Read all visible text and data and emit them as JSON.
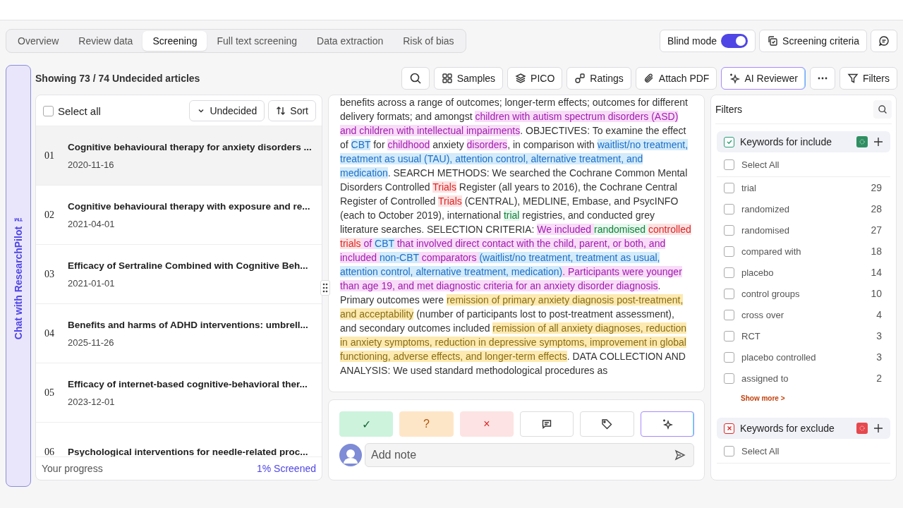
{
  "tabs": [
    {
      "label": "Overview",
      "selected": false
    },
    {
      "label": "Review data",
      "selected": false
    },
    {
      "label": "Screening",
      "selected": true
    },
    {
      "label": "Full text screening",
      "selected": false
    },
    {
      "label": "Data extraction",
      "selected": false
    },
    {
      "label": "Risk of bias",
      "selected": false
    }
  ],
  "blind_mode": {
    "label": "Blind mode",
    "on": true
  },
  "criteria_button": "Screening criteria",
  "chat_tab": "Chat with ResearchPilot ™",
  "heading": "Showing 73 / 74 Undecided articles",
  "toolbar": [
    {
      "label": "Samples",
      "kind": "plain"
    },
    {
      "label": "PICO",
      "kind": "plain"
    },
    {
      "label": "Ratings",
      "kind": "plain"
    },
    {
      "label": "Attach PDF",
      "kind": "plain"
    },
    {
      "label": "AI Reviewer",
      "kind": "ai"
    },
    {
      "label": "Filters",
      "kind": "plain"
    }
  ],
  "list": {
    "select_all": {
      "label": "Select all",
      "checked": false
    },
    "status_filter": "Undecided",
    "sort": "Sort",
    "articles": [
      {
        "number": "01",
        "title": "Cognitive behavioural therapy for anxiety disorders ...",
        "date": "2020-11-16",
        "selected": true
      },
      {
        "number": "02",
        "title": "Cognitive behavioural therapy with exposure and re...",
        "date": "2021-04-01",
        "selected": false
      },
      {
        "number": "03",
        "title": "Efficacy of Sertraline Combined with Cognitive Beh...",
        "date": "2021-01-01",
        "selected": false
      },
      {
        "number": "04",
        "title": "Benefits and harms of ADHD interventions: umbrell...",
        "date": "2025-11-26",
        "selected": false
      },
      {
        "number": "05",
        "title": "Efficacy of internet-based cognitive-behavioral ther...",
        "date": "2023-12-01",
        "selected": false
      },
      {
        "number": "06",
        "title": "Psychological interventions for needle-related proc...",
        "selected": false
      }
    ],
    "progress_label": "Your progress",
    "progress_value": "1% Screened"
  },
  "abstract": [
    {
      "kind": "plain",
      "text": "benefits across a range of outcomes; longer-term effects; outcomes for different delivery formats; and amongst "
    },
    {
      "kind": "population",
      "text": "children with autism spectrum disorders (ASD) and children with intellectual impairments"
    },
    {
      "kind": "plain",
      "text": ". OBJECTIVES: To examine the effect of "
    },
    {
      "kind": "intervention",
      "text": "CBT"
    },
    {
      "kind": "plain",
      "text": " for "
    },
    {
      "kind": "population",
      "text": "childhood"
    },
    {
      "kind": "plain",
      "text": " anxiety "
    },
    {
      "kind": "population",
      "text": "disorders"
    },
    {
      "kind": "plain",
      "text": ", in comparison with "
    },
    {
      "kind": "intervention",
      "text": "waitlist/no treatment, treatment as usual (TAU), attention control, alternative treatment, and medication"
    },
    {
      "kind": "plain",
      "text": ". SEARCH METHODS: We searched the Cochrane Common Mental Disorders Controlled "
    },
    {
      "kind": "exclude_keyword",
      "text": "Trials"
    },
    {
      "kind": "plain",
      "text": " Register (all years to 2016), the Cochrane Central Register of Controlled "
    },
    {
      "kind": "exclude_keyword",
      "text": "Trials"
    },
    {
      "kind": "plain",
      "text": " (CENTRAL), MEDLINE, Embase, and PsycINFO (each to October 2019), international "
    },
    {
      "kind": "include_keyword",
      "text": "trial"
    },
    {
      "kind": "plain",
      "text": " registries, and conducted grey literature searches. SELECTION CRITERIA: "
    },
    {
      "kind": "population",
      "text": "We included "
    },
    {
      "kind": "include_keyword",
      "text": "randomised "
    },
    {
      "kind": "exclude_keyword",
      "text": "controlled trials"
    },
    {
      "kind": "population",
      "text": " of "
    },
    {
      "kind": "intervention",
      "text": "CBT"
    },
    {
      "kind": "population",
      "text": " that involved direct contact with the child, parent, or both, and included "
    },
    {
      "kind": "intervention",
      "text": "non-CBT"
    },
    {
      "kind": "population",
      "text": " comparators "
    },
    {
      "kind": "intervention",
      "text": "(waitlist/no treatment, treatment as usual, attention control, alternative treatment, medication)"
    },
    {
      "kind": "population",
      "text": ". Participants were younger than age 19, and met diagnostic criteria for an anxiety disorder diagnosis"
    },
    {
      "kind": "plain",
      "text": ". Primary outcomes were "
    },
    {
      "kind": "outcome",
      "text": "remission of primary anxiety diagnosis post-treatment, and acceptability"
    },
    {
      "kind": "plain",
      "text": " (number of participants lost to post-treatment assessment), and secondary outcomes included "
    },
    {
      "kind": "outcome",
      "text": "remission of all anxiety diagnoses, reduction in anxiety symptoms, reduction in depressive symptoms, improvement in global functioning, adverse effects, and longer-term effects"
    },
    {
      "kind": "plain",
      "text": ". DATA COLLECTION AND ANALYSIS: We used standard methodological procedures as"
    }
  ],
  "decisions": [
    {
      "kind": "include",
      "label": "✓"
    },
    {
      "kind": "maybe",
      "label": "?"
    },
    {
      "kind": "exclude",
      "label": "×"
    }
  ],
  "note": {
    "placeholder": "Add note"
  },
  "filters": {
    "title": "Filters",
    "groups": [
      {
        "kind": "include",
        "title": "Keywords for include",
        "checked": true,
        "select_all": {
          "label": "Select All",
          "checked": false
        },
        "items": [
          {
            "label": "trial",
            "count": "29",
            "checked": false
          },
          {
            "label": "randomized",
            "count": "28",
            "checked": false
          },
          {
            "label": "randomised",
            "count": "27",
            "checked": false
          },
          {
            "label": "compared with",
            "count": "18",
            "checked": false
          },
          {
            "label": "placebo",
            "count": "14",
            "checked": false
          },
          {
            "label": "control groups",
            "count": "10",
            "checked": false
          },
          {
            "label": "cross over",
            "count": "4",
            "checked": false
          },
          {
            "label": "RCT",
            "count": "3",
            "checked": false
          },
          {
            "label": "placebo controlled",
            "count": "3",
            "checked": false
          },
          {
            "label": "assigned to",
            "count": "2",
            "checked": false
          }
        ],
        "show_more": "Show more >"
      },
      {
        "kind": "exclude",
        "title": "Keywords for exclude",
        "checked": true,
        "select_all": {
          "label": "Select All",
          "checked": false
        }
      }
    ]
  }
}
